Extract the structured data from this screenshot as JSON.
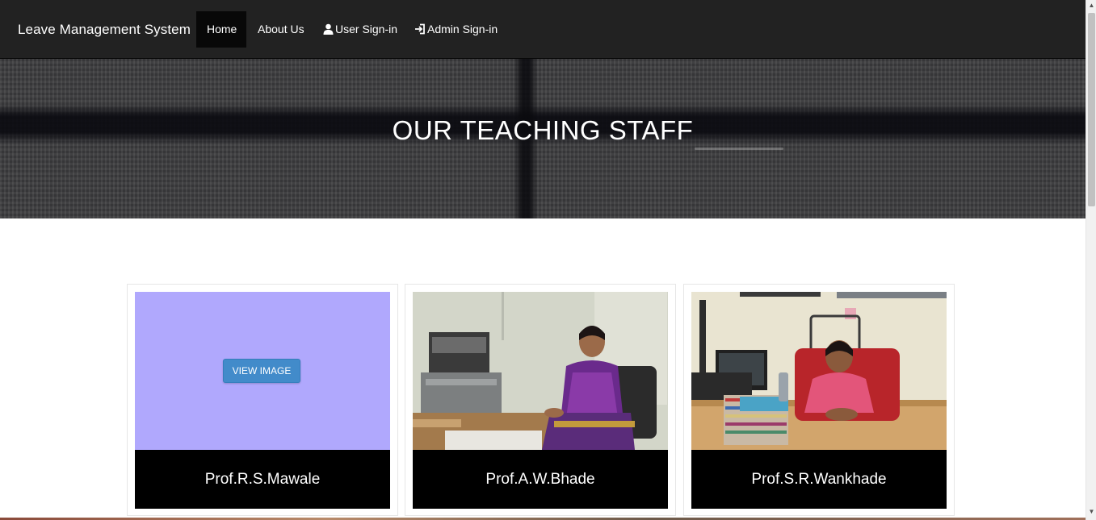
{
  "navbar": {
    "brand": "Leave Management System",
    "items": [
      {
        "label": "Home",
        "active": true
      },
      {
        "label": "About Us",
        "active": false
      },
      {
        "label": "User Sign-in",
        "icon": "user-icon"
      },
      {
        "label": "Admin Sign-in",
        "icon": "sign-in-icon"
      }
    ],
    "colors": {
      "background": "#222222",
      "active_background": "#080808"
    }
  },
  "hero": {
    "title": "OUR TEACHING STAFF"
  },
  "staff": [
    {
      "name": "Prof.R.S.Mawale",
      "image_state": "placeholder",
      "button_label": "VIEW IMAGE",
      "placeholder_color": "#b0a8fd"
    },
    {
      "name": "Prof.A.W.Bhade",
      "image_state": "photo"
    },
    {
      "name": "Prof.S.R.Wankhade",
      "image_state": "photo"
    }
  ],
  "button_color": "#428bca"
}
